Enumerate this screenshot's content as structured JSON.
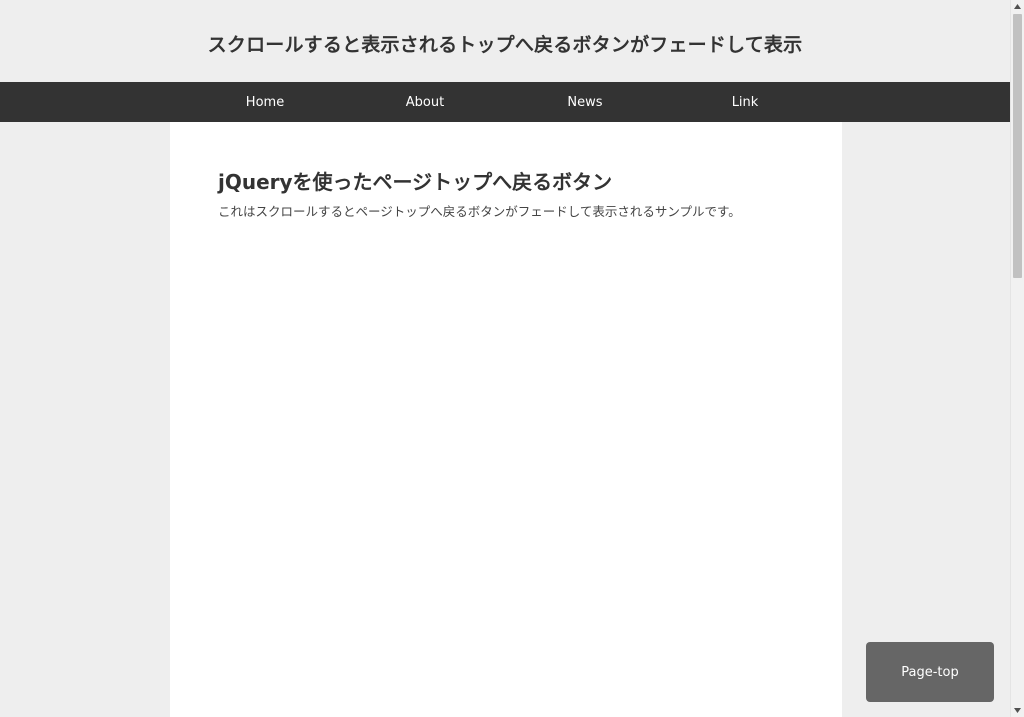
{
  "header": {
    "title": "スクロールすると表示されるトップへ戻るボタンがフェードして表示"
  },
  "nav": {
    "items": [
      {
        "label": "Home"
      },
      {
        "label": "About"
      },
      {
        "label": "News"
      },
      {
        "label": "Link"
      }
    ]
  },
  "main": {
    "heading": "jQueryを使ったページトップへ戻るボタン",
    "text": "これはスクロールするとページトップへ戻るボタンがフェードして表示されるサンプルです。"
  },
  "page_top_button": {
    "label": "Page-top"
  },
  "colors": {
    "background": "#eeeeee",
    "nav_background": "#333333",
    "content_background": "#ffffff",
    "button_background": "#666666"
  },
  "scrollbar": {
    "up_icon": "triangle-up-icon",
    "down_icon": "triangle-down-icon"
  }
}
